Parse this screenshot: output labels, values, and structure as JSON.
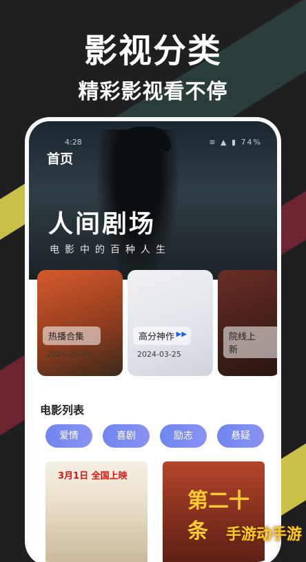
{
  "headline": {
    "title": "影视分类",
    "subtitle": "精彩影视看不停"
  },
  "status_bar": {
    "time": "4:28",
    "icons_text": "≋ ▲ ▮ 74%"
  },
  "app": {
    "tab_home": "首页",
    "hero": {
      "title": "人间剧场",
      "subtitle": "电影中的百种人生"
    },
    "cards": [
      {
        "label": "热播合集",
        "date": "2024-03-25"
      },
      {
        "label": "高分神作",
        "date": "2024-03-25"
      },
      {
        "label": "院线上新",
        "date": ""
      }
    ],
    "section_title": "电影列表",
    "chips": [
      "爱情",
      "喜剧",
      "励志",
      "悬疑"
    ],
    "posters": [
      {
        "top_text": "3月1日 全国上映"
      },
      {
        "title": "第二十条"
      }
    ]
  },
  "watermark": "手游动手游",
  "colors": {
    "chip": "#7b8cf1",
    "accent_yellow": "#c9c04a",
    "accent_red": "#6b2430"
  }
}
